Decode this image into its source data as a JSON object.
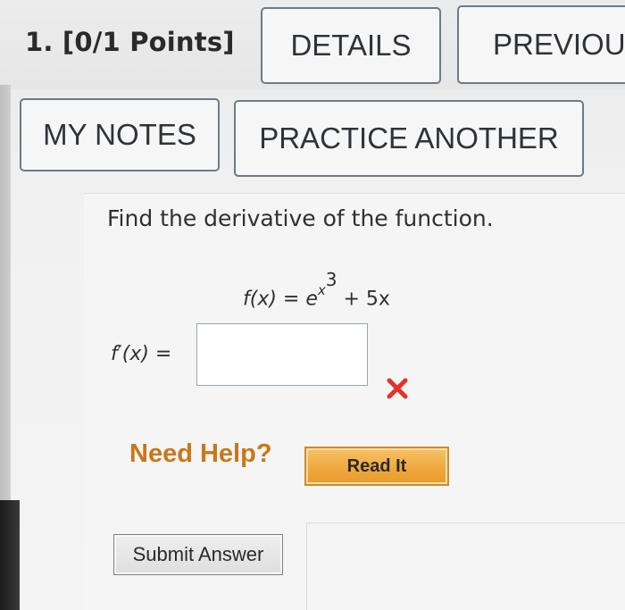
{
  "question": {
    "number_label": "1. [0/1 Points]"
  },
  "header_buttons": {
    "details": "DETAILS",
    "previous": "PREVIOU",
    "my_notes": "MY NOTES",
    "practice_another": "PRACTICE ANOTHER"
  },
  "problem": {
    "prompt": "Find the derivative of the function.",
    "function_lhs": "f(x) = e",
    "exponent_base": "x",
    "exponent_power": "3",
    "function_tail": " + 5x",
    "answer_label": "f′(x) =",
    "answer_value": "",
    "result_icon": "incorrect-x-icon",
    "result_color": "#e0342b"
  },
  "help": {
    "label": "Need Help?",
    "read_it": "Read It"
  },
  "submit": {
    "label": "Submit Answer"
  },
  "colors": {
    "help_text": "#c8771c",
    "read_it_button": "#eea73c"
  }
}
